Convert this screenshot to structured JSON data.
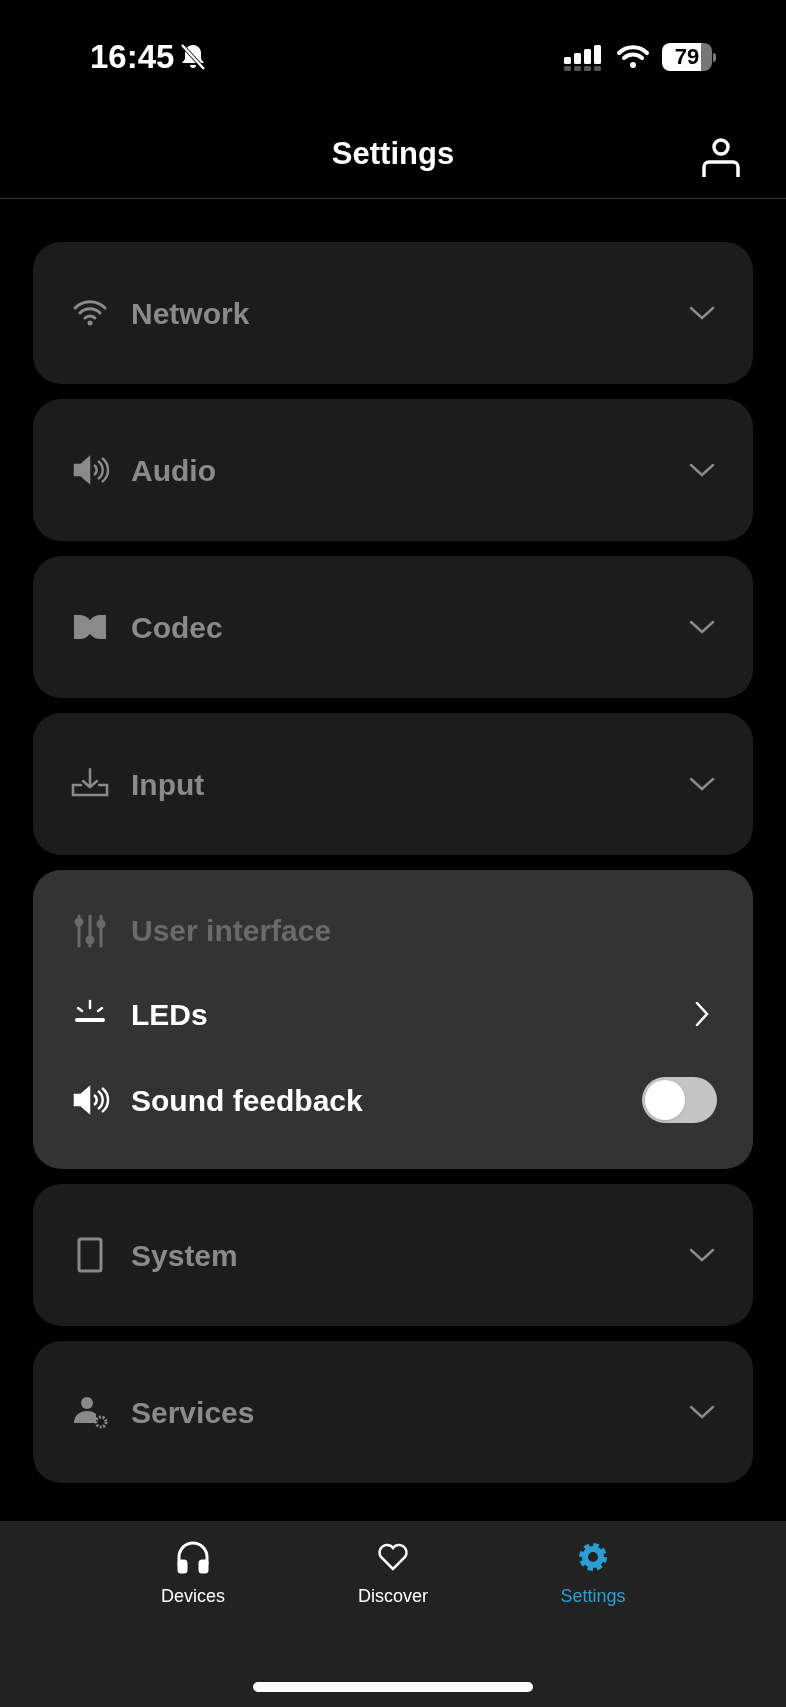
{
  "status_bar": {
    "time": "16:45",
    "battery": "79"
  },
  "header": {
    "title": "Settings"
  },
  "sections": [
    {
      "kind": "collapsed",
      "label": "Network",
      "expanded": false
    },
    {
      "kind": "collapsed",
      "label": "Audio",
      "expanded": false
    },
    {
      "kind": "collapsed",
      "label": "Codec",
      "expanded": false
    },
    {
      "kind": "collapsed",
      "label": "Input",
      "expanded": false
    },
    {
      "kind": "group",
      "label": "User interface",
      "expanded": true,
      "items": [
        {
          "kind": "link",
          "label": "LEDs"
        },
        {
          "kind": "toggle",
          "label": "Sound feedback",
          "on": false
        }
      ]
    },
    {
      "kind": "collapsed",
      "label": "System",
      "expanded": false
    },
    {
      "kind": "collapsed",
      "label": "Services",
      "expanded": false
    }
  ],
  "tab_bar": [
    {
      "label": "Devices",
      "selected": false
    },
    {
      "label": "Discover",
      "selected": false
    },
    {
      "label": "Settings",
      "selected": true
    }
  ]
}
